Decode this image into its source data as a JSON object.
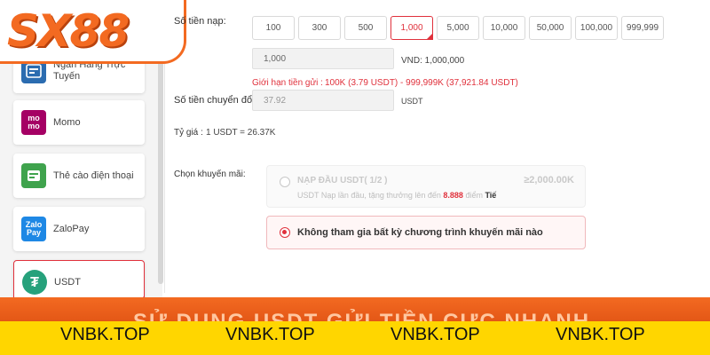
{
  "logo": {
    "text": "SX88",
    "color": "#f36a21"
  },
  "payment_methods": [
    {
      "label": "Ngân Hàng Trực Tuyến",
      "icon": "bank-transfer-icon",
      "icon_color": "#2b6cb0"
    },
    {
      "label": "Momo",
      "icon": "momo-icon",
      "icon_text": "mo mo",
      "icon_color": "#a50064"
    },
    {
      "label": "Thẻ cào điện thoại",
      "icon": "phone-card-icon",
      "icon_color": "#3fa34d"
    },
    {
      "label": "ZaloPay",
      "icon": "zalopay-icon",
      "icon_text": "Zalo Pay",
      "icon_color": "#1e88e5"
    },
    {
      "label": "USDT",
      "icon": "tether-icon",
      "icon_text": "₮",
      "icon_color": "#26a17b",
      "selected": true
    }
  ],
  "deposit": {
    "amount_label": "Số tiền nạp:",
    "amounts": [
      "100",
      "300",
      "500",
      "1,000",
      "5,000",
      "10,000",
      "50,000",
      "100,000",
      "999,999"
    ],
    "selected_amount": "1,000",
    "amount_value": "1,000",
    "vnd_text": "VND: 1,000,000",
    "limit_label": "Giới hạn tiền gửi :",
    "limit_value": "100K (3.79 USDT) - 999,999K (37,921.84 USDT)",
    "convert_label": "Số tiền chuyển đổi:",
    "convert_value": "37.92",
    "convert_unit": "USDT",
    "rate_label": "Tỷ giá :",
    "rate_value": "1  USDT  = 26.37K"
  },
  "promotion": {
    "label": "Chọn khuyến mãi:",
    "option1_title": "NẠP ĐẦU USDT( 1/2 )",
    "option1_amount": "≥2,000.00K",
    "option1_desc_a": "USDT Nạp lần đầu, tặng thưởng lên đến",
    "option1_highlight": "8.888",
    "option1_desc_b": "điểm",
    "option1_link": "Tiế",
    "option2_text": "Không tham gia bất kỳ chương trình khuyến mãi nào"
  },
  "banner": {
    "ghost_text": "SỬ DỤNG USDT GỬI TIỀN CỰC NHANH",
    "watermarks": [
      "VNBK.TOP",
      "VNBK.TOP",
      "VNBK.TOP",
      "VNBK.TOP"
    ]
  }
}
